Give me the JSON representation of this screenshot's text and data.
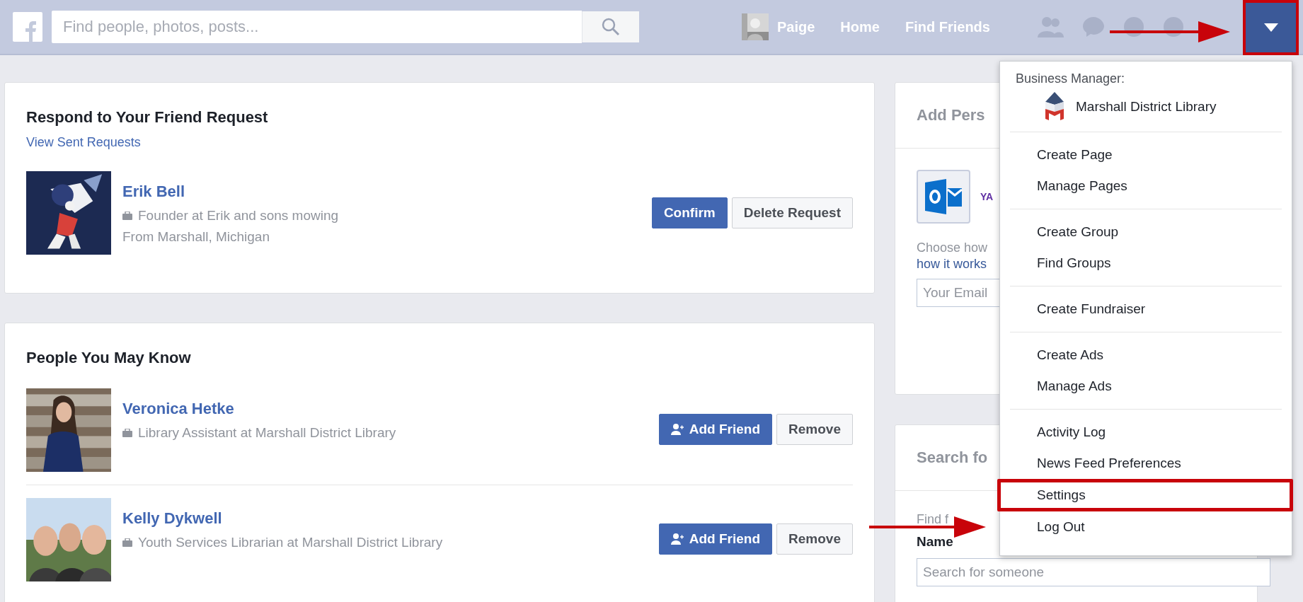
{
  "top_bar": {
    "search": {
      "placeholder": "Find people, photos, posts..."
    },
    "profile_name": "Paige",
    "nav_links": [
      "Home",
      "Find Friends"
    ],
    "menu_button": {
      "expanded": true
    }
  },
  "friend_requests": {
    "title": "Respond to Your Friend Request",
    "link": "View Sent Requests",
    "requests": [
      {
        "name": "Erik Bell",
        "work": "Founder at Erik and sons mowing",
        "from": "From Marshall, Michigan",
        "confirm": "Confirm",
        "delete": "Delete Request"
      }
    ]
  },
  "people_you_may_know": {
    "title": "People You May Know",
    "people": [
      {
        "name": "Veronica Hetke",
        "work": "Library Assistant at Marshall District Library",
        "add": "Add Friend",
        "remove": "Remove"
      },
      {
        "name": "Kelly Dykwell",
        "work": "Youth Services Librarian at Marshall District Library",
        "add": "Add Friend",
        "remove": "Remove"
      }
    ]
  },
  "add_contacts": {
    "title": "Add Pers",
    "provider": "YA",
    "text": "Choose how",
    "link": "how it works",
    "email": {
      "placeholder": "Your Email"
    }
  },
  "search_friends": {
    "title": "Search fo",
    "hint": "Find f",
    "name_label": "Name",
    "search": {
      "placeholder": "Search for someone"
    }
  },
  "dropdown": {
    "header": "Business Manager:",
    "business": "Marshall District Library",
    "groups": [
      [
        {
          "label": "Create Page",
          "selected": false
        },
        {
          "label": "Manage Pages",
          "selected": false
        }
      ],
      [
        {
          "label": "Create Group",
          "selected": false
        },
        {
          "label": "Find Groups",
          "selected": false
        }
      ],
      [
        {
          "label": "Create Fundraiser",
          "selected": false
        }
      ],
      [
        {
          "label": "Create Ads",
          "selected": false
        },
        {
          "label": "Manage Ads",
          "selected": false
        }
      ],
      [
        {
          "label": "Activity Log",
          "selected": false
        },
        {
          "label": "News Feed Preferences",
          "selected": false
        },
        {
          "label": "Settings",
          "selected": true
        },
        {
          "label": "Log Out",
          "selected": false
        }
      ]
    ]
  }
}
